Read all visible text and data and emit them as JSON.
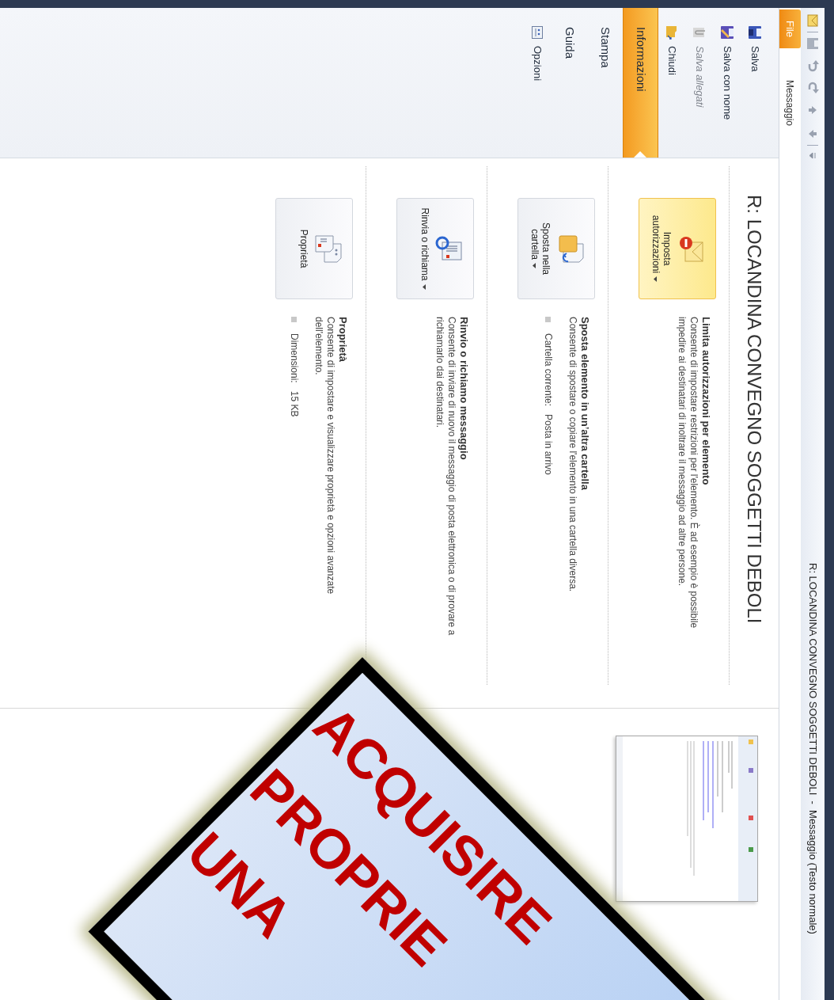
{
  "window": {
    "title": "R: LOCANDINA CONVEGNO SOGGETTI DEBOLI  -  Messaggio (Testo normale)"
  },
  "ribbon_tabs": [
    {
      "label": "File",
      "selected": true
    },
    {
      "label": "Messaggio",
      "selected": false
    }
  ],
  "backstage_nav": [
    {
      "label": "Salva",
      "kind": "command",
      "disabled": false,
      "selected": false
    },
    {
      "label": "Salva con nome",
      "kind": "command",
      "disabled": false,
      "selected": false
    },
    {
      "label": "Salva allegati",
      "kind": "command",
      "disabled": true,
      "selected": false
    },
    {
      "label": "Chiudi",
      "kind": "command",
      "disabled": false,
      "selected": false
    },
    {
      "label": "Informazioni",
      "kind": "page",
      "disabled": false,
      "selected": true
    },
    {
      "label": "Stampa",
      "kind": "page",
      "disabled": false,
      "selected": false
    },
    {
      "label": "Guida",
      "kind": "page",
      "disabled": false,
      "selected": false
    },
    {
      "label": "Opzioni",
      "kind": "command",
      "disabled": false,
      "selected": false
    }
  ],
  "info": {
    "title": "R: LOCANDINA CONVEGNO SOGGETTI DEBOLI",
    "sections": [
      {
        "button": {
          "label": "Imposta autorizzazioni",
          "dropdown": true,
          "highlighted": true
        },
        "heading": "Limita autorizzazioni per elemento",
        "description": "Consente di impostare restrizioni per l'elemento. È ad esempio è possibile impedire ai destinatari di inoltrare il messaggio ad altre persone."
      },
      {
        "button": {
          "label": "Sposta nella cartella",
          "dropdown": true,
          "highlighted": false
        },
        "heading": "Sposta elemento in un’altra cartella",
        "description": "Consente di spostare o copiare l'elemento in una cartella diversa.",
        "details": [
          {
            "label": "Cartella corrente:",
            "value": "Posta in arrivo"
          }
        ]
      },
      {
        "button": {
          "label": "Rinvia o richiama",
          "dropdown": true,
          "highlighted": false
        },
        "heading": "Rinvio o richiamo messaggio",
        "description": "Consente di inviare di nuovo il messaggio di posta elettronica o di provare a richiamarlo dai destinatari."
      },
      {
        "button": {
          "label": "Proprietà",
          "dropdown": false,
          "highlighted": false
        },
        "heading": "Proprietà",
        "description": "Consente di impostare e visualizzare proprietà e opzioni avanzate dell'elemento.",
        "details": [
          {
            "label": "Dimensioni:",
            "value": "15 KB"
          }
        ]
      }
    ]
  },
  "overlay_sign": {
    "lines": [
      "ACQUISIRE",
      "PROPRIE",
      "UNA"
    ]
  }
}
